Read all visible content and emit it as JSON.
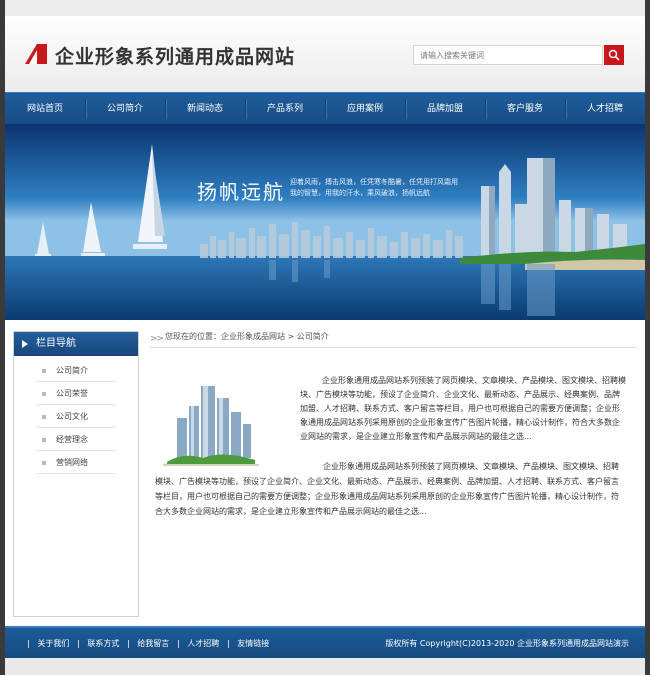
{
  "site": {
    "title": "企业形象系列通用成品网站",
    "brand_color": "#c8161d",
    "nav_color": "#1a5290"
  },
  "search": {
    "placeholder": "请输入搜索关键词",
    "button_icon": "search-icon"
  },
  "nav": {
    "items": [
      {
        "label": "网站首页"
      },
      {
        "label": "公司简介"
      },
      {
        "label": "新闻动态"
      },
      {
        "label": "产品系列"
      },
      {
        "label": "应用案例"
      },
      {
        "label": "品牌加盟"
      },
      {
        "label": "客户服务"
      },
      {
        "label": "人才招聘"
      }
    ]
  },
  "banner": {
    "title": "扬帆远航",
    "subtitle": "迎着风雨，搏击风浪，任凭寒冬酷暑，任凭用打风霜用我的智慧，用我的汗水，乘风破浪，扬帆远航"
  },
  "sidebar": {
    "title": "栏目导航",
    "items": [
      {
        "label": "公司简介"
      },
      {
        "label": "公司荣誉"
      },
      {
        "label": "公司文化"
      },
      {
        "label": "经营理念"
      },
      {
        "label": "营销网络"
      }
    ]
  },
  "breadcrumb": {
    "prefix": "您现在的位置：",
    "home": "企业形象成品网站",
    "sep": ">",
    "current": "公司简介"
  },
  "content": {
    "para1": "企业形象通用成品网站系列预装了网页模块、文章模块、产品模块、图文模块、招聘模块、广告模块等功能，预设了企业简介、企业文化、最新动态、产品展示、经典案例、品牌加盟、人才招聘、联系方式、客户留言等栏目，用户也可根据自己的需要方便调整；企业形象通用成品网站系列采用原创的企业形象宣传广告图片轮播，精心设计制作，符合大多数企业网站的需求，是企业建立形象宣传和产品展示网站的最佳之选...",
    "para2": "企业形象通用成品网站系列预装了网页模块、文章模块、产品模块、图文模块、招聘模块、广告模块等功能，预设了企业简介、企业文化、最新动态、产品展示、经典案例、品牌加盟、人才招聘、联系方式、客户留言等栏目，用户也可根据自己的需要方便调整；企业形象通用成品网站系列采用原创的企业形象宣传广告图片轮播，精心设计制作，符合大多数企业网站的需求，是企业建立形象宣传和产品展示网站的最佳之选..."
  },
  "footer": {
    "links": [
      {
        "label": "关于我们"
      },
      {
        "label": "联系方式"
      },
      {
        "label": "给我留言"
      },
      {
        "label": "人才招聘"
      },
      {
        "label": "友情链接"
      }
    ],
    "separator": "|",
    "copyright": "版权所有 Copyright(C)2013-2020 企业形象系列通用成品网站演示"
  }
}
